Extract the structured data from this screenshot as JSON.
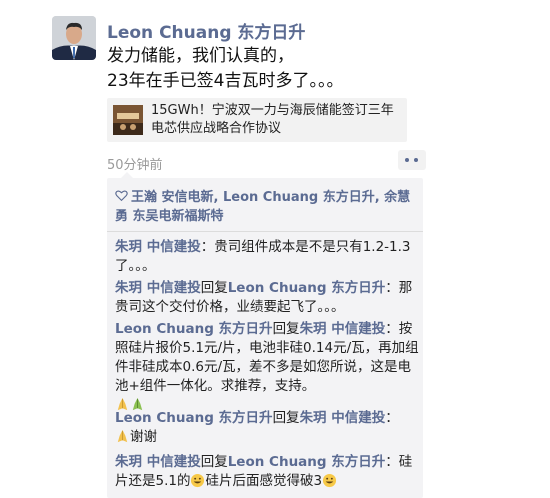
{
  "post": {
    "author": "Leon Chuang 东方日升",
    "lines": [
      "发力储能，我们认真的，",
      "23年在手已签4吉瓦时多了。。。"
    ],
    "link_title": "15GWh！宁波双一力与海辰储能签订三年电芯供应战略合作协议",
    "time": "50分钟前"
  },
  "likes": {
    "icon": "heart-outline-icon",
    "names": "王瀚 安信电新, Leon Chuang 东方日升, 余慧勇 东吴电新福斯特"
  },
  "comments": [
    {
      "from": "朱玥 中信建投",
      "to": "",
      "reply_word": "",
      "text": "：贵司组件成本是不是只有1.2-1.3了。。。"
    },
    {
      "from": "朱玥 中信建投",
      "to": "Leon Chuang 东方日升",
      "reply_word": "回复",
      "text": "：那贵司这个交付价格，业绩要起飞了。。。"
    },
    {
      "from": "Leon Chuang 东方日升",
      "to": "朱玥 中信建投",
      "reply_word": "回复",
      "text": "：按照硅片报价5.1元/片，电池非硅0.14元/瓦，再加组件非硅成本0.6元/瓦，差不多是如您所说，这是电池+组件一体化。求推荐，支持。",
      "emojis": [
        "pray-emoji",
        "pray-emoji"
      ]
    },
    {
      "from": "Leon Chuang 东方日升",
      "to": "朱玥 中信建投",
      "reply_word": "回复",
      "text": "：",
      "emojis": [
        "pray-emoji"
      ],
      "tail": "谢谢"
    },
    {
      "from": "朱玥 中信建投",
      "to": "Leon Chuang 东方日升",
      "reply_word": "回复",
      "text": "：硅片还是5.1的",
      "emojis": [
        "grin-emoji"
      ],
      "tail": "硅片后面感觉得破3",
      "emojis2": [
        "grin-emoji"
      ]
    }
  ]
}
